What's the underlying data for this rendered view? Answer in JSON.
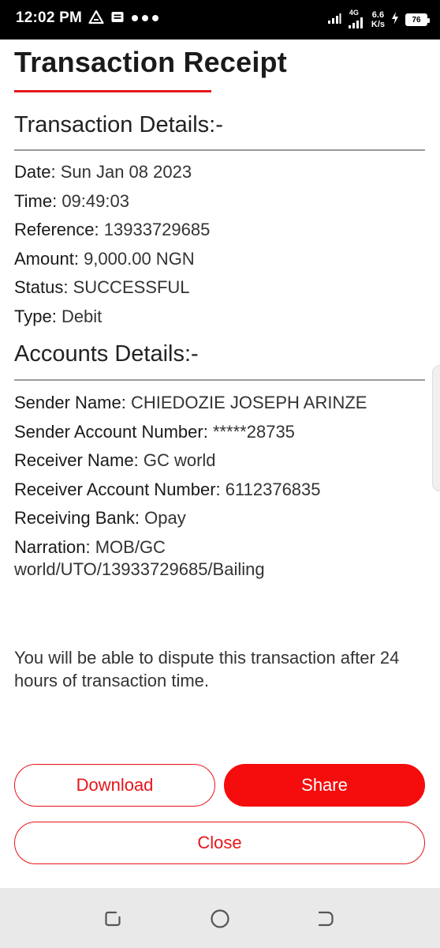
{
  "status_bar": {
    "time": "12:02 PM",
    "network": "4G",
    "speed_value": "6.6",
    "speed_unit": "K/s",
    "battery_level": "76"
  },
  "receipt": {
    "title": "Transaction Receipt",
    "transaction_section": {
      "heading": "Transaction Details:-",
      "rows": [
        {
          "label": "Date:",
          "value": "Sun Jan 08 2023"
        },
        {
          "label": "Time:",
          "value": "09:49:03"
        },
        {
          "label": "Reference:",
          "value": "13933729685"
        },
        {
          "label": "Amount:",
          "value": "9,000.00 NGN"
        },
        {
          "label": "Status:",
          "value": "SUCCESSFUL"
        },
        {
          "label": "Type:",
          "value": "Debit"
        }
      ]
    },
    "accounts_section": {
      "heading": "Accounts Details:-",
      "rows": [
        {
          "label": "Sender Name:",
          "value": "CHIEDOZIE JOSEPH ARINZE"
        },
        {
          "label": "Sender Account Number:",
          "value": "*****28735"
        },
        {
          "label": "Receiver Name:",
          "value": "GC world"
        },
        {
          "label": "Receiver Account Number:",
          "value": "6112376835"
        },
        {
          "label": "Receiving Bank:",
          "value": "Opay"
        },
        {
          "label": "Narration:",
          "value": "MOB/GC world/UTO/13933729685/Bailing"
        }
      ]
    },
    "dispute_note": "You will be able to dispute this transaction after 24 hours of transaction time."
  },
  "actions": {
    "download_label": "Download",
    "share_label": "Share",
    "close_label": "Close"
  },
  "colors": {
    "accent": "#f50c0c",
    "status_bar_bg": "#000000",
    "nav_bar_bg": "#e9e9e9"
  },
  "icons": {
    "status_left": [
      "alert-triangle-icon",
      "message-icon",
      "more-dots-icon"
    ],
    "status_right": [
      "wifi-signal-icon",
      "cell-signal-icon",
      "charging-bolt-icon",
      "battery-icon"
    ],
    "nav": [
      "recents-icon",
      "home-icon",
      "back-icon"
    ]
  }
}
